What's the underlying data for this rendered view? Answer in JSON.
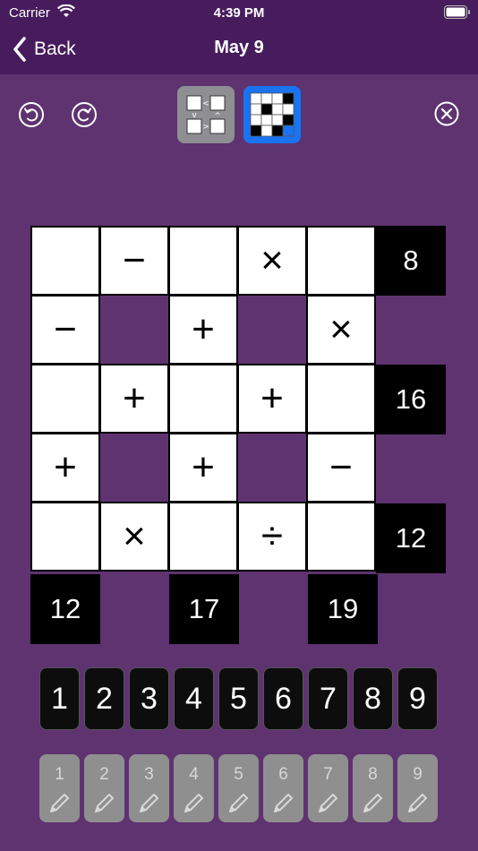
{
  "status": {
    "carrier": "Carrier",
    "time": "4:39 PM"
  },
  "nav": {
    "back_label": "Back",
    "title": "May 9"
  },
  "toolbar": {
    "undo_icon": "undo-icon",
    "redo_icon": "redo-icon",
    "mode_inequality_icon": "inequality-mode-icon",
    "mode_crossword_icon": "crossword-mode-icon",
    "close_icon": "close-icon",
    "active_mode_color": "#1a73f0"
  },
  "puzzle": {
    "rows": [
      [
        "",
        "−",
        "",
        "×",
        "",
        "8"
      ],
      [
        "−",
        null,
        "+",
        null,
        "×",
        null
      ],
      [
        "",
        "+",
        "",
        "+",
        "",
        "16"
      ],
      [
        "+",
        null,
        "+",
        null,
        "−",
        null
      ],
      [
        "",
        "×",
        "",
        "÷",
        "",
        "12"
      ],
      [
        "12",
        null,
        "17",
        null,
        "19",
        null
      ]
    ],
    "row_clues": [
      "8",
      "16",
      "12"
    ],
    "column_clues": [
      "12",
      "17",
      "19"
    ]
  },
  "number_keys": [
    "1",
    "2",
    "3",
    "4",
    "5",
    "6",
    "7",
    "8",
    "9"
  ],
  "note_keys": [
    "1",
    "2",
    "3",
    "4",
    "5",
    "6",
    "7",
    "8",
    "9"
  ],
  "colors": {
    "background": "#5e3370",
    "bar": "#471c5d"
  }
}
